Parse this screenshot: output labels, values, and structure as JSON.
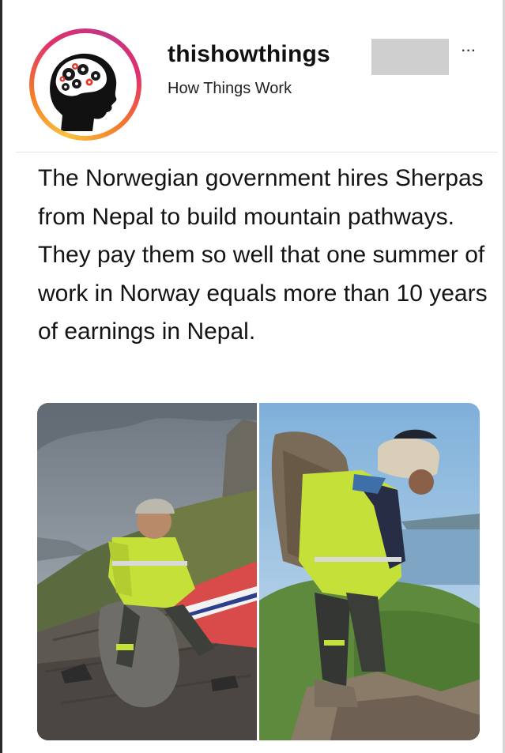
{
  "post": {
    "username": "thishowthings",
    "subtitle": "How Things Work",
    "more_label": "···",
    "caption": "The Norwegian government hires Sherpas from Nepal to build mountain pathways. They pay them so well that one summer of work in Norway equals more than 10 years of earnings in Nepal."
  },
  "icons": {
    "avatar": "brain-gears-head-icon",
    "more": "more-dots-icon"
  },
  "colors": {
    "ring_gradient": [
      "#f9c23c",
      "#f47b2a",
      "#e1306c",
      "#c13584"
    ],
    "redaction": "#cfcfcf",
    "hi_vis": "#c8e635"
  }
}
